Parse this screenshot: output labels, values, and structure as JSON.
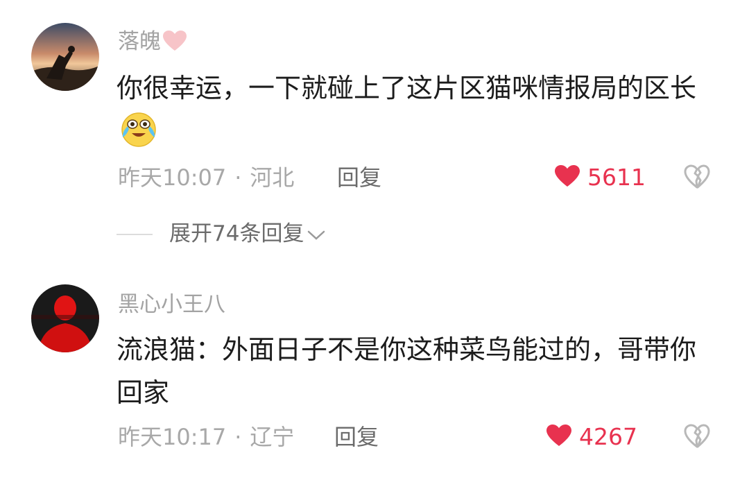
{
  "comments": [
    {
      "username": "落魄",
      "username_badge_icon": "pink-heart-icon",
      "text": "你很幸运，一下就碰上了这片区猫咪情报局的区长",
      "inline_emoji": "crying-laughing-emoji-icon",
      "time": "昨天10:07",
      "separator": "·",
      "location": "河北",
      "reply_label": "回复",
      "likes": "5611",
      "like_icon": "red-heart-icon",
      "dislike_icon": "broken-heart-icon",
      "expand_label": "展开74条回复"
    },
    {
      "username": "黑心小王八",
      "text": "流浪猫：外面日子不是你这种菜鸟能过的，哥带你回家",
      "time": "昨天10:17",
      "separator": "·",
      "location": "辽宁",
      "reply_label": "回复",
      "likes": "4267",
      "like_icon": "red-heart-icon",
      "dislike_icon": "broken-heart-icon"
    }
  ],
  "colors": {
    "like_red": "#e8324f",
    "meta_gray": "#a8a8a8",
    "text_dark": "#1c1c1c"
  }
}
